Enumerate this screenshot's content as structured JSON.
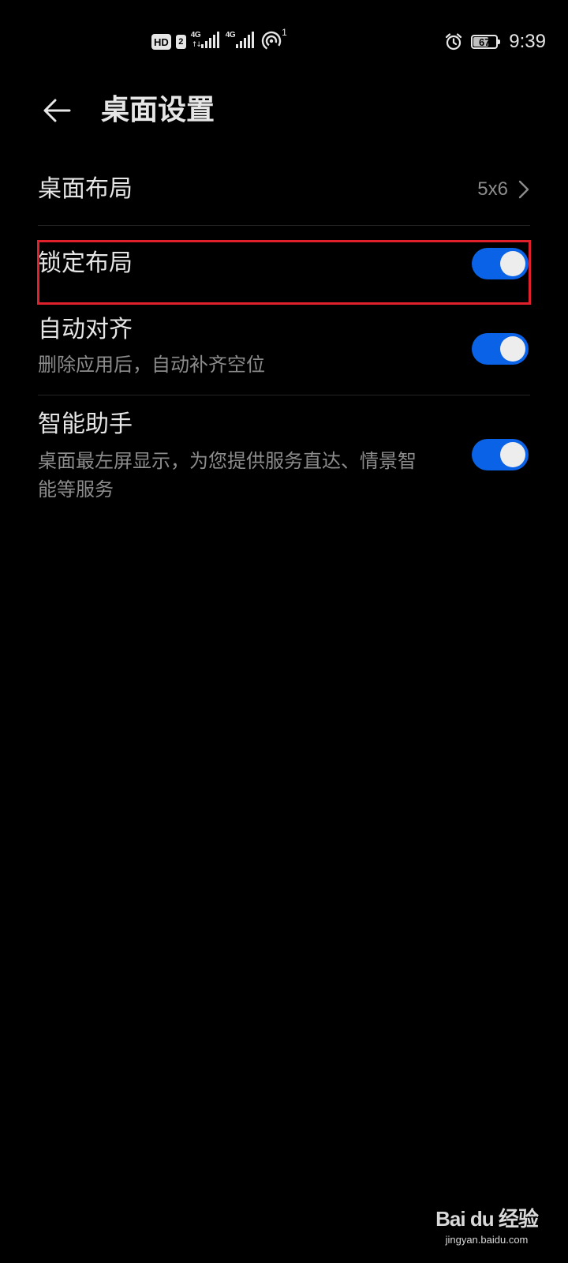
{
  "status_bar": {
    "hd_label": "HD",
    "hd_sim": "2",
    "network_1": "4G",
    "network_2": "4G",
    "hotspot_count": "1",
    "battery_percent": "67",
    "battery_level": 0.67,
    "time": "9:39"
  },
  "header": {
    "title": "桌面设置"
  },
  "settings": {
    "layout": {
      "title": "桌面布局",
      "value": "5x6"
    },
    "lock_layout": {
      "title": "锁定布局",
      "enabled": true
    },
    "auto_align": {
      "title": "自动对齐",
      "subtitle": "删除应用后，自动补齐空位",
      "enabled": true
    },
    "smart_assistant": {
      "title": "智能助手",
      "subtitle": "桌面最左屏显示，为您提供服务直达、情景智能等服务",
      "enabled": true
    }
  },
  "colors": {
    "accent": "#0a62e6",
    "highlight": "#e0202a",
    "background": "#000000"
  },
  "watermark": {
    "logo": "Bai du 经验",
    "url": "jingyan.baidu.com"
  }
}
